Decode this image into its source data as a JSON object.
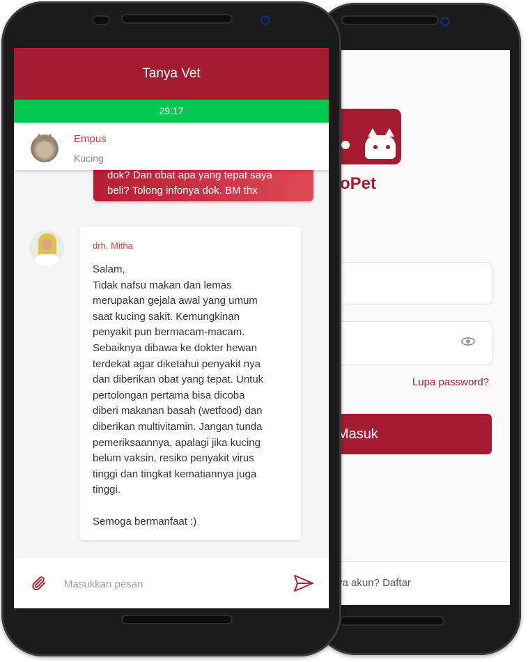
{
  "chat_screen": {
    "title": "Tanya Vet",
    "timer": "29:17",
    "pet": {
      "name": "Empus",
      "type": "Kucing"
    },
    "user_message_lines": [
      "dok? Dan obat apa yang tepat saya",
      "beli? Tolong infonya dok. BM thx"
    ],
    "vet": {
      "name": "drh. Mitha",
      "message_lines": [
        "Salam,",
        "Tidak nafsu makan dan lemas",
        "merupakan gejala awal yang umum",
        "saat kucing sakit. Kemungkinan",
        "penyakit pun bermacam-macam.",
        "Sebaiknya dibawa ke dokter hewan",
        "terdekat agar diketahui penyakit nya",
        "dan diberikan obat yang tepat. Untuk",
        "pertolongan pertama bisa dicoba",
        "diberi makanan basah (wetfood) dan",
        "diberikan multivitamin. Jangan tunda",
        "pemeriksaannya, apalagi jika kucing",
        "belum vaksin, resiko penyakit virus",
        "tinggi dan tingkat kematiannya juga",
        "tinggi.",
        "",
        "Semoga bermanfaat :)"
      ]
    },
    "input_placeholder": "Masukkan pesan"
  },
  "login_screen": {
    "logo_text": "oPet",
    "forgot_password": "Lupa password?",
    "login_button": "Masuk",
    "signup_prompt": "ya akun?",
    "signup_link": "Daftar"
  },
  "colors": {
    "brand": "#a51c30",
    "timer_green": "#00c851",
    "accent_text": "#d23a3a"
  },
  "icons": [
    "paperclip-icon",
    "send-icon",
    "eye-icon"
  ]
}
